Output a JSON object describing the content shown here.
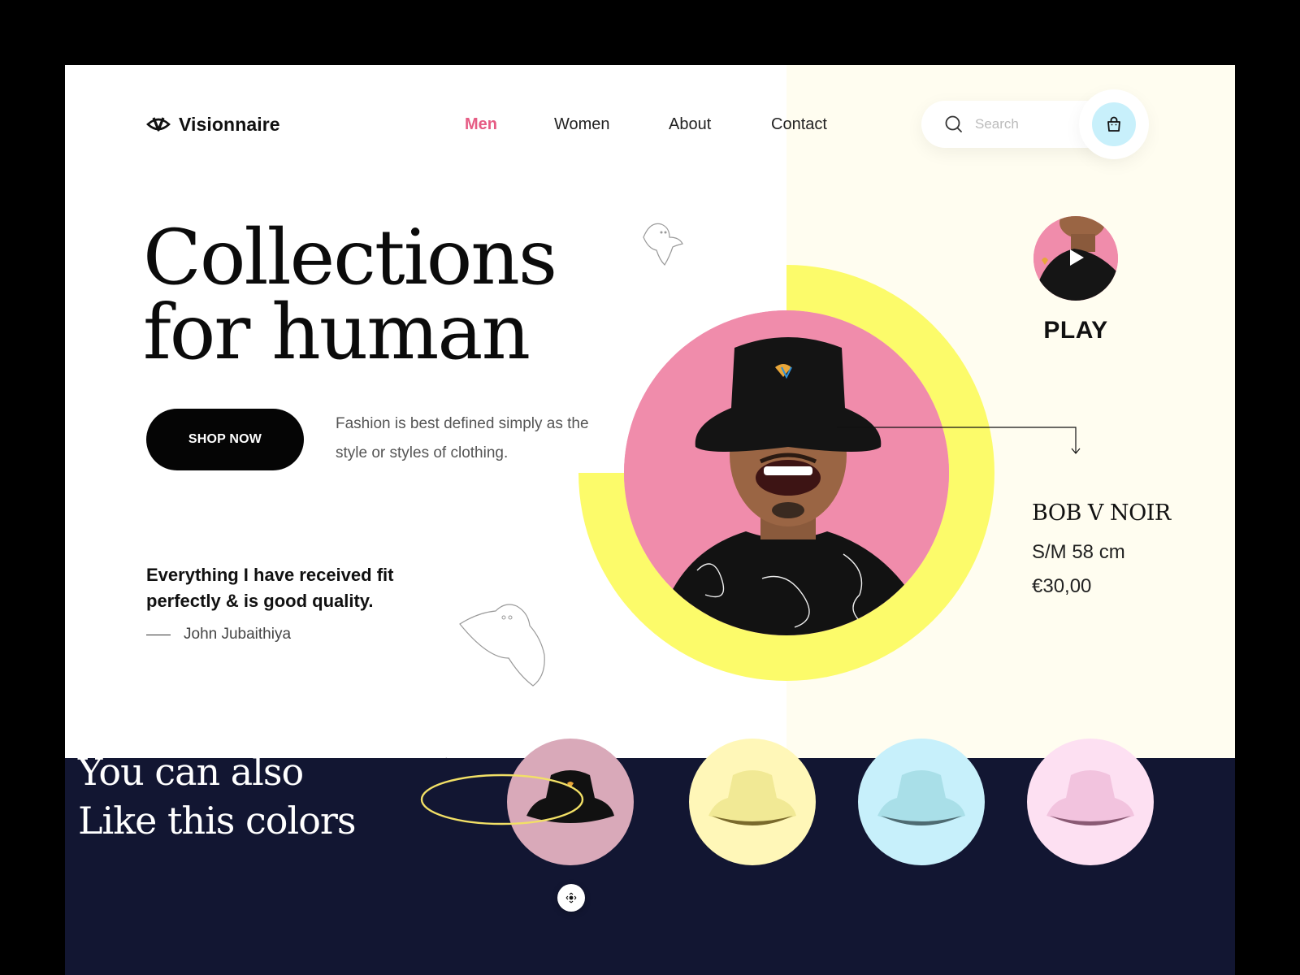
{
  "brand": {
    "name": "Visionnaire",
    "logo_icon": "eye-v-logo"
  },
  "nav": {
    "items": [
      {
        "label": "Men",
        "active": true
      },
      {
        "label": "Women",
        "active": false
      },
      {
        "label": "About",
        "active": false
      },
      {
        "label": "Contact",
        "active": false
      }
    ]
  },
  "search": {
    "placeholder": "Search",
    "value": ""
  },
  "cart": {
    "icon": "shopping-bag-icon"
  },
  "hero": {
    "title_line1": "Collections",
    "title_line2": "for human",
    "cta_label": "SHOP NOW",
    "tagline": "Fashion is best defined simply as the style or styles of clothing."
  },
  "testimonial": {
    "quote": "Everything I have received fit perfectly & is good quality.",
    "author": "John Jubaithiya"
  },
  "video": {
    "label": "PLAY",
    "icon": "play-icon"
  },
  "product": {
    "name": "BOB V NOIR",
    "size": "S/M 58 cm",
    "price": "€30,00"
  },
  "colors_section": {
    "title_line1": "You can also",
    "title_line2": "Like this colors",
    "swatches": [
      {
        "name": "black",
        "bg": "#d9a9b9",
        "hat": "#111111",
        "selected": true
      },
      {
        "name": "yellow",
        "bg": "#fff7b8",
        "hat": "#f4ec9a",
        "selected": false
      },
      {
        "name": "blue",
        "bg": "#c7f0fb",
        "hat": "#a9dfe8",
        "selected": false
      },
      {
        "name": "pink",
        "bg": "#fde0f2",
        "hat": "#f2c3de",
        "selected": false
      }
    ]
  },
  "colors": {
    "accent": "#e65c84",
    "yellow": "#fcfb6a",
    "navy": "#121632",
    "cream": "#fffdf0",
    "pink_photo": "#f08cab",
    "cart_bg": "#c8f0fb"
  }
}
